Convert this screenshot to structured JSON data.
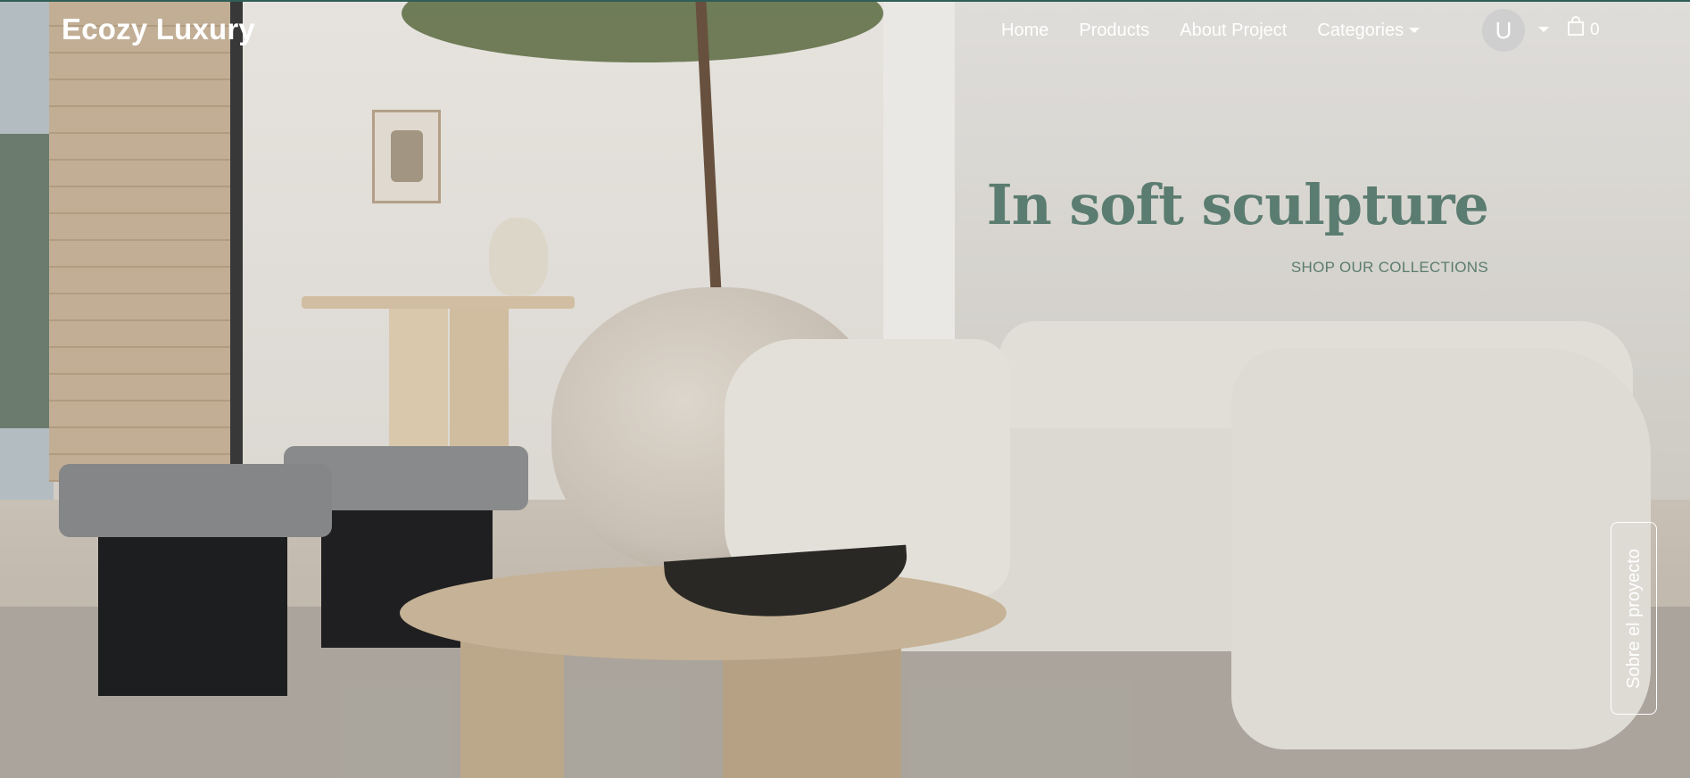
{
  "brand": {
    "name": "Ecozy Luxury"
  },
  "nav": {
    "items": [
      {
        "label": "Home"
      },
      {
        "label": "Products"
      },
      {
        "label": "About Project"
      },
      {
        "label": "Categories",
        "has_dropdown": true
      }
    ],
    "user": {
      "initial": "U",
      "has_dropdown": true
    },
    "cart": {
      "icon": "shopping-bag-icon",
      "count": "0"
    }
  },
  "hero": {
    "headline": "In soft sculpture",
    "cta_label": "SHOP OUR COLLECTIONS"
  },
  "side_tab": {
    "label": "Sobre el proyecto"
  },
  "colors": {
    "accent": "#5b7c71",
    "nav_text": "#ffffff",
    "avatar_bg": "#cfcfcf",
    "top_border": "#2f5e58"
  }
}
